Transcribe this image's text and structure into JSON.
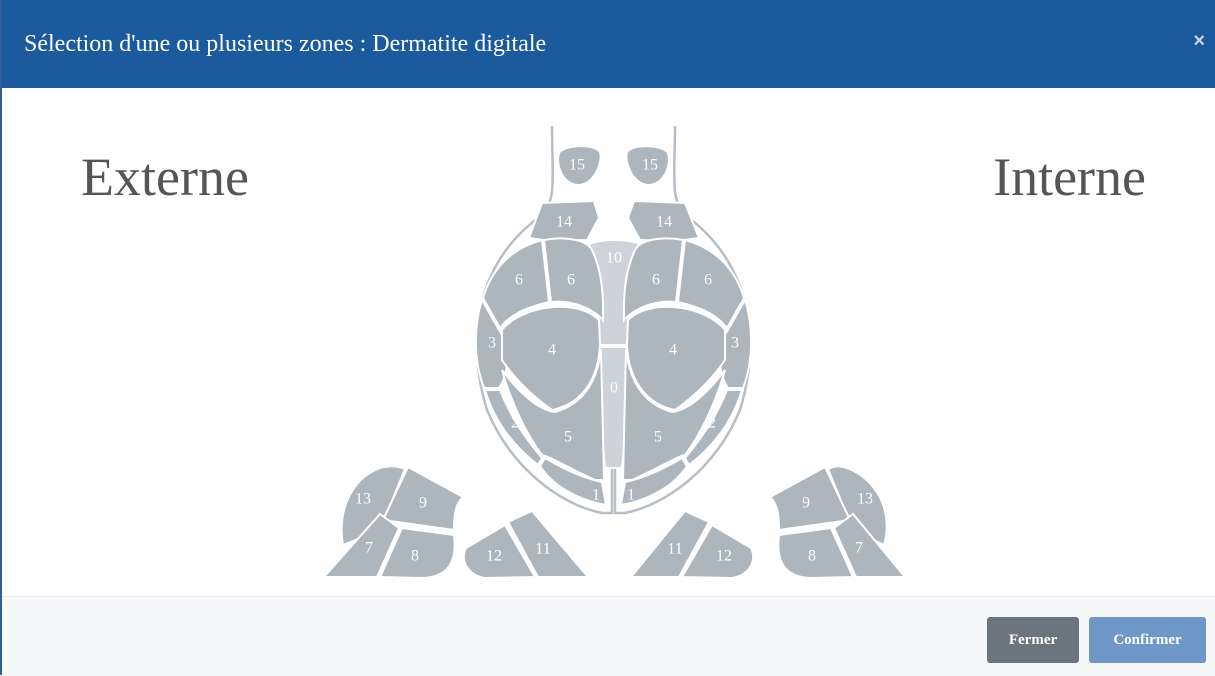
{
  "modal": {
    "title": "Sélection d'une ou plusieurs zones : Dermatite digitale",
    "close_symbol": "×"
  },
  "labels": {
    "left": "Externe",
    "right": "Interne"
  },
  "zones": {
    "z0": "0",
    "z1l": "1",
    "z1r": "1",
    "z2l": "2",
    "z2r": "2",
    "z3l": "3",
    "z3r": "3",
    "z4l": "4",
    "z4r": "4",
    "z5l": "5",
    "z5r": "5",
    "z6l1": "6",
    "z6l2": "6",
    "z6r1": "6",
    "z6r2": "6",
    "z7l": "7",
    "z7r": "7",
    "z8l": "8",
    "z8r": "8",
    "z9l": "9",
    "z9r": "9",
    "z10": "10",
    "z11l": "11",
    "z11r": "11",
    "z12l": "12",
    "z12r": "12",
    "z13l": "13",
    "z13r": "13",
    "z14l": "14",
    "z14r": "14",
    "z15l": "15",
    "z15r": "15"
  },
  "footer": {
    "close_label": "Fermer",
    "confirm_label": "Confirmer"
  },
  "colors": {
    "header": "#1b5a9c",
    "zone": "#adb5bd",
    "zone_light": "#ced3d9",
    "btn_close": "#6c757d",
    "btn_confirm": "#6f98c8"
  },
  "icons": {
    "close": "close-icon"
  }
}
